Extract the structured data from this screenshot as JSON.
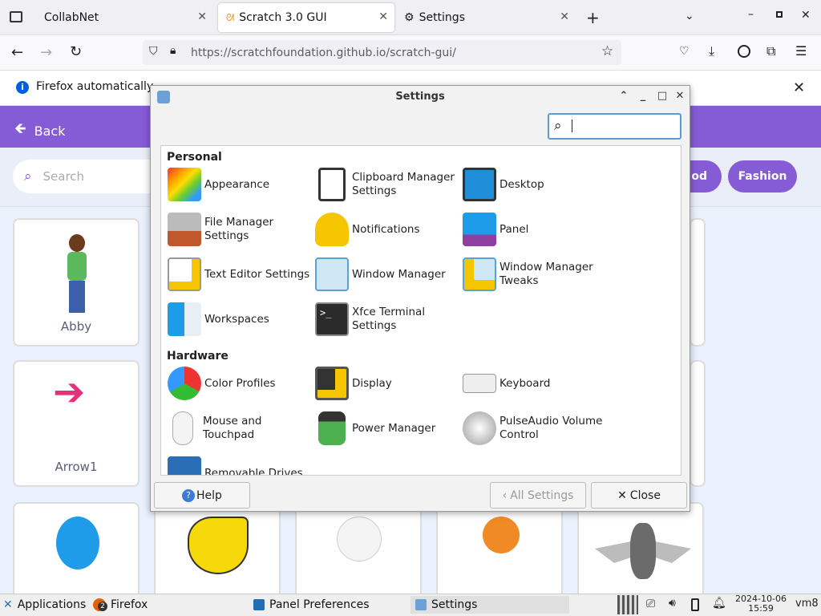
{
  "browser": {
    "tabs": [
      {
        "label": "CollabNet"
      },
      {
        "label": "Scratch 3.0 GUI"
      },
      {
        "label": "Settings"
      }
    ],
    "url": "https://scratchfoundation.github.io/scratch-gui/",
    "infobar_text": "Firefox automatically"
  },
  "scratch": {
    "back_label": "Back",
    "search_placeholder": "Search",
    "pills": [
      "od",
      "Fashion"
    ],
    "cards": [
      {
        "label": "Abby"
      },
      {
        "label": "Arrow1"
      }
    ]
  },
  "settings": {
    "title": "Settings",
    "sections": [
      {
        "name": "Personal",
        "items": [
          "Appearance",
          "Clipboard Manager\nSettings",
          "Desktop",
          "File Manager\nSettings",
          "Notifications",
          "Panel",
          "Text Editor Settings",
          "Window Manager",
          "Window Manager\nTweaks",
          "Workspaces",
          "Xfce Terminal\nSettings"
        ]
      },
      {
        "name": "Hardware",
        "items": [
          "Color Profiles",
          "Display",
          "Keyboard",
          "Mouse and\nTouchpad",
          "Power Manager",
          "PulseAudio Volume\nControl",
          "Removable Drives"
        ]
      }
    ],
    "help_label": "Help",
    "all_settings_label": "All Settings",
    "close_label": "Close"
  },
  "taskbar": {
    "applications": "Applications",
    "firefox": "Firefox",
    "firefox_badge": "2",
    "panel_prefs": "Panel Preferences",
    "settings": "Settings",
    "date": "2024-10-06",
    "time": "15:59",
    "host": "vm8"
  }
}
